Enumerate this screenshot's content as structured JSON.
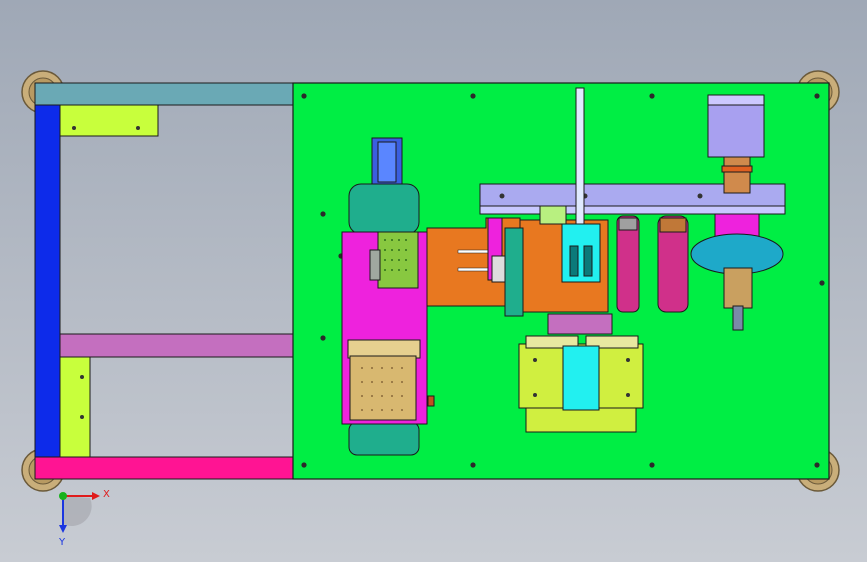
{
  "viewport": {
    "background": "#a9b0bc"
  },
  "colors": {
    "plate": "#00ee44",
    "frame_top": "#6aa9b5",
    "frame_left": "#0d2bea",
    "frame_bottom": "#ff1493",
    "bracket": "#c8ff3c",
    "rail": "#c46fbf",
    "magenta": "#ee22dd",
    "orange": "#e87820",
    "teal": "#1fae8d",
    "cyan": "#22f0f0",
    "lavender": "#aaaaf0",
    "yellow_green": "#d0ef40",
    "tan": "#d8b870",
    "caster": "#c9ae7a"
  },
  "triad": {
    "x_label": "X",
    "y_label": "Y",
    "x_color": "#e01b1b",
    "y_color": "#1b36e0",
    "origin_color": "#17b21b"
  }
}
